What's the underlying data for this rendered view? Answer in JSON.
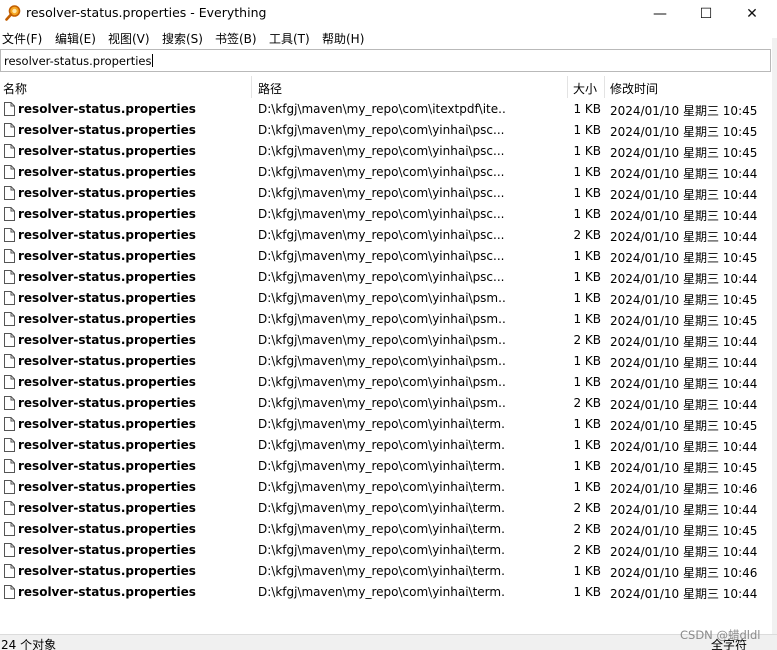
{
  "window": {
    "title": "resolver-status.properties - Everything",
    "minimize_glyph": "—",
    "maximize_glyph": "☐",
    "close_glyph": "✕",
    "icon": "magnifier-icon"
  },
  "menu": {
    "items": [
      {
        "label": "文件(F)"
      },
      {
        "label": "编辑(E)"
      },
      {
        "label": "视图(V)"
      },
      {
        "label": "搜索(S)"
      },
      {
        "label": "书签(B)"
      },
      {
        "label": "工具(T)"
      },
      {
        "label": "帮助(H)"
      }
    ]
  },
  "search": {
    "value": "resolver-status.properties"
  },
  "columns": {
    "name": "名称",
    "path": "路径",
    "size": "大小",
    "modified": "修改时间"
  },
  "rows": [
    {
      "name": "resolver-status.properties",
      "path": "D:\\kfgj\\maven\\my_repo\\com\\itextpdf\\ite...",
      "size": "1 KB",
      "modified": "2024/01/10 星期三 10:45"
    },
    {
      "name": "resolver-status.properties",
      "path": "D:\\kfgj\\maven\\my_repo\\com\\yinhai\\psc...",
      "size": "1 KB",
      "modified": "2024/01/10 星期三 10:45"
    },
    {
      "name": "resolver-status.properties",
      "path": "D:\\kfgj\\maven\\my_repo\\com\\yinhai\\psc...",
      "size": "1 KB",
      "modified": "2024/01/10 星期三 10:45"
    },
    {
      "name": "resolver-status.properties",
      "path": "D:\\kfgj\\maven\\my_repo\\com\\yinhai\\psc...",
      "size": "1 KB",
      "modified": "2024/01/10 星期三 10:44"
    },
    {
      "name": "resolver-status.properties",
      "path": "D:\\kfgj\\maven\\my_repo\\com\\yinhai\\psc...",
      "size": "1 KB",
      "modified": "2024/01/10 星期三 10:44"
    },
    {
      "name": "resolver-status.properties",
      "path": "D:\\kfgj\\maven\\my_repo\\com\\yinhai\\psc...",
      "size": "1 KB",
      "modified": "2024/01/10 星期三 10:44"
    },
    {
      "name": "resolver-status.properties",
      "path": "D:\\kfgj\\maven\\my_repo\\com\\yinhai\\psc...",
      "size": "2 KB",
      "modified": "2024/01/10 星期三 10:44"
    },
    {
      "name": "resolver-status.properties",
      "path": "D:\\kfgj\\maven\\my_repo\\com\\yinhai\\psc...",
      "size": "1 KB",
      "modified": "2024/01/10 星期三 10:45"
    },
    {
      "name": "resolver-status.properties",
      "path": "D:\\kfgj\\maven\\my_repo\\com\\yinhai\\psc...",
      "size": "1 KB",
      "modified": "2024/01/10 星期三 10:44"
    },
    {
      "name": "resolver-status.properties",
      "path": "D:\\kfgj\\maven\\my_repo\\com\\yinhai\\psm...",
      "size": "1 KB",
      "modified": "2024/01/10 星期三 10:45"
    },
    {
      "name": "resolver-status.properties",
      "path": "D:\\kfgj\\maven\\my_repo\\com\\yinhai\\psm...",
      "size": "1 KB",
      "modified": "2024/01/10 星期三 10:45"
    },
    {
      "name": "resolver-status.properties",
      "path": "D:\\kfgj\\maven\\my_repo\\com\\yinhai\\psm...",
      "size": "2 KB",
      "modified": "2024/01/10 星期三 10:44"
    },
    {
      "name": "resolver-status.properties",
      "path": "D:\\kfgj\\maven\\my_repo\\com\\yinhai\\psm...",
      "size": "1 KB",
      "modified": "2024/01/10 星期三 10:44"
    },
    {
      "name": "resolver-status.properties",
      "path": "D:\\kfgj\\maven\\my_repo\\com\\yinhai\\psm...",
      "size": "1 KB",
      "modified": "2024/01/10 星期三 10:44"
    },
    {
      "name": "resolver-status.properties",
      "path": "D:\\kfgj\\maven\\my_repo\\com\\yinhai\\psm...",
      "size": "2 KB",
      "modified": "2024/01/10 星期三 10:44"
    },
    {
      "name": "resolver-status.properties",
      "path": "D:\\kfgj\\maven\\my_repo\\com\\yinhai\\term...",
      "size": "1 KB",
      "modified": "2024/01/10 星期三 10:45"
    },
    {
      "name": "resolver-status.properties",
      "path": "D:\\kfgj\\maven\\my_repo\\com\\yinhai\\term...",
      "size": "1 KB",
      "modified": "2024/01/10 星期三 10:44"
    },
    {
      "name": "resolver-status.properties",
      "path": "D:\\kfgj\\maven\\my_repo\\com\\yinhai\\term...",
      "size": "1 KB",
      "modified": "2024/01/10 星期三 10:45"
    },
    {
      "name": "resolver-status.properties",
      "path": "D:\\kfgj\\maven\\my_repo\\com\\yinhai\\term...",
      "size": "1 KB",
      "modified": "2024/01/10 星期三 10:46"
    },
    {
      "name": "resolver-status.properties",
      "path": "D:\\kfgj\\maven\\my_repo\\com\\yinhai\\term...",
      "size": "2 KB",
      "modified": "2024/01/10 星期三 10:44"
    },
    {
      "name": "resolver-status.properties",
      "path": "D:\\kfgj\\maven\\my_repo\\com\\yinhai\\term...",
      "size": "2 KB",
      "modified": "2024/01/10 星期三 10:45"
    },
    {
      "name": "resolver-status.properties",
      "path": "D:\\kfgj\\maven\\my_repo\\com\\yinhai\\term...",
      "size": "2 KB",
      "modified": "2024/01/10 星期三 10:44"
    },
    {
      "name": "resolver-status.properties",
      "path": "D:\\kfgj\\maven\\my_repo\\com\\yinhai\\term...",
      "size": "1 KB",
      "modified": "2024/01/10 星期三 10:46"
    },
    {
      "name": "resolver-status.properties",
      "path": "D:\\kfgj\\maven\\my_repo\\com\\yinhai\\term...",
      "size": "1 KB",
      "modified": "2024/01/10 星期三 10:44"
    }
  ],
  "status": {
    "count": "24 个对象",
    "mode": "全字符"
  },
  "watermark": "CSDN @蜡dldl",
  "colors": {
    "icon_orange": "#e8850c",
    "statusbar_bg": "#f0f0f0"
  }
}
